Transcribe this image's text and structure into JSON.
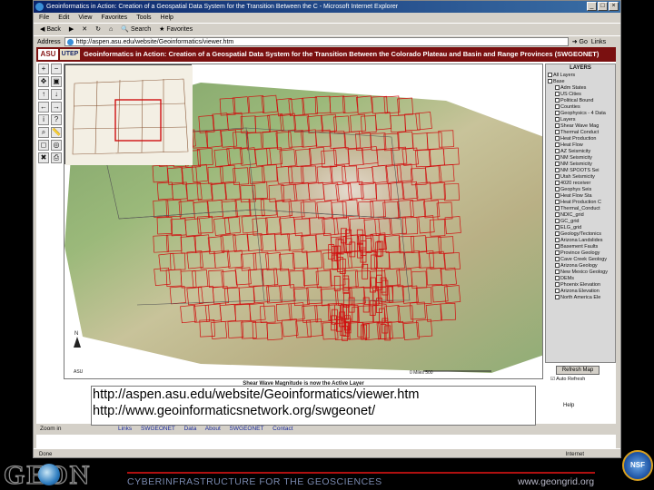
{
  "window": {
    "title": "Geoinformatics in Action: Creation of a Geospatial Data System for the Transition Between the C - Microsoft Internet Explorer",
    "controls": [
      "_",
      "□",
      "×"
    ]
  },
  "menu": [
    "File",
    "Edit",
    "View",
    "Favorites",
    "Tools",
    "Help"
  ],
  "toolbar": {
    "back": "Back",
    "search": "Search",
    "favorites": "Favorites"
  },
  "address": {
    "label": "Address",
    "url": "http://aspen.asu.edu/website/Geoinformatics/viewer.htm",
    "go": "Go",
    "links": "Links"
  },
  "app": {
    "header": "Geoinformatics in Action: Creation of a Geospatial Data System for the Transition Between the Colorado Plateau and Basin and Range Provinces (SWGEONET)",
    "asu_logo": "ASU",
    "utep_logo": "UTEP",
    "active_layer": "Shear Wave Magnitude is now the Active Layer",
    "zoom_label": "Zoom in",
    "bottom_links": "Links  SWGEONET  Data  About SWGEONET  Contact",
    "refresh_button": "Refresh Map",
    "auto_refresh": "Auto Refresh",
    "help": "Help",
    "layers_title": "LAYERS",
    "layers": [
      "All Layers",
      "Base",
      "Adm States",
      "US Cities",
      "Political Bound",
      "Counties",
      "Geophysics - 4 Data",
      "Layers",
      "Shear Wave Mag",
      "Thermal Conduct",
      "Heat Production",
      "Heat Flow",
      "AZ Seismicity",
      "NM Seismicity",
      "NM Seismicity",
      "NM SPOOTS Sei",
      "Utah Seismicity",
      "4020 receiver",
      "Geophys Seis",
      "Heat Flow Sta",
      "Heat Production C",
      "Thermal_Conduct",
      "NDIC_grid",
      "GC_grid",
      "ELG_grid",
      "Geology/Tectonics",
      "Arizona Landslides",
      "Basement Faults",
      "Province Geology",
      "Cave Creek Geology",
      "Arizona Geology",
      "New Mexico Geology",
      "DEMs",
      "Phoenix Elevation",
      "Arizona Elevation",
      "North America Ele"
    ],
    "scale_text": "0 Miles 500",
    "copyright": "ASU"
  },
  "overlay_urls": [
    "http://aspen.asu.edu/website/Geoinformatics/viewer.htm",
    "http://www.geoinformaticsnetwork.org/swgeonet/"
  ],
  "status": {
    "left": "Done",
    "zone": "Internet"
  },
  "footer": {
    "geon": "GEON",
    "tagline": "CYBERINFRASTRUCTURE FOR THE GEOSCIENCES",
    "website": "www.geongrid.org",
    "nsf": "NSF"
  },
  "colors": {
    "header_bg": "#7a1010",
    "grid_red": "#d01010",
    "window_chrome": "#d4d0c8",
    "titlebar": "#0a246a"
  }
}
